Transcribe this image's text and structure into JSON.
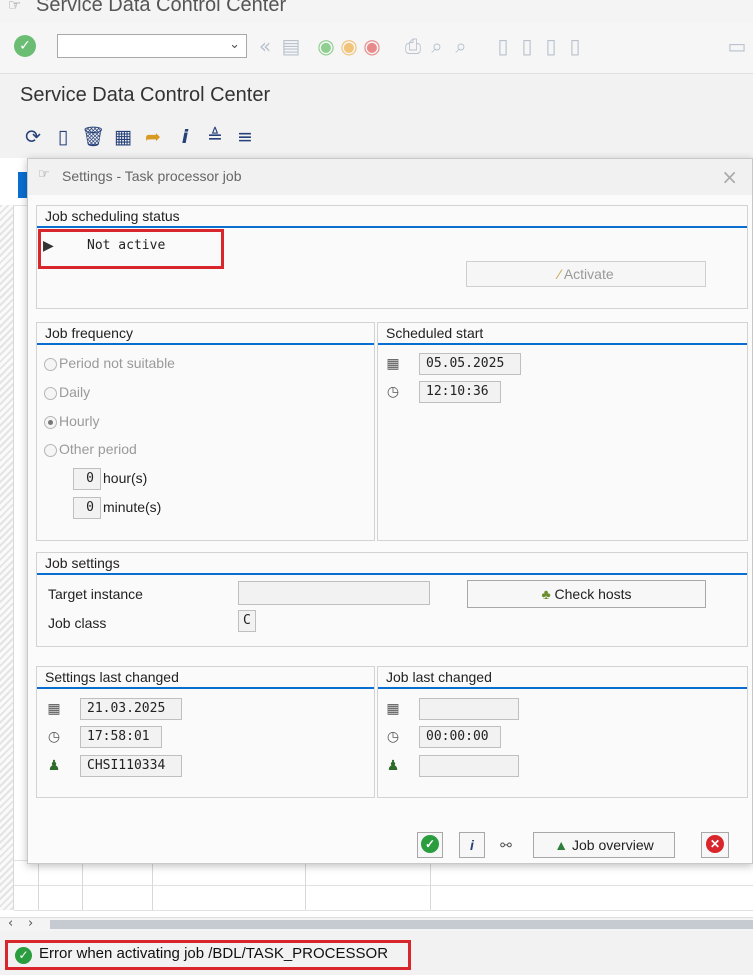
{
  "window": {
    "title": "Service Data Control Center"
  },
  "app": {
    "title": "Service Data Control Center"
  },
  "toolbar": {
    "command_field_value": ""
  },
  "dialog": {
    "title": "Settings - Task processor job",
    "status_group": {
      "heading": "Job scheduling status",
      "status": "Not active",
      "activate_label": "Activate"
    },
    "frequency": {
      "heading": "Job frequency",
      "options": [
        "Period not suitable",
        "Daily",
        "Hourly",
        "Other period"
      ],
      "selected": "Hourly",
      "hours_value": "0",
      "hours_label": "hour(s)",
      "minutes_value": "0",
      "minutes_label": "minute(s)"
    },
    "scheduled_start": {
      "heading": "Scheduled start",
      "date": "05.05.2025",
      "time": "12:10:36"
    },
    "job_settings": {
      "heading": "Job settings",
      "target_instance_label": "Target instance",
      "target_instance_value": "",
      "job_class_label": "Job class",
      "job_class_value": "C",
      "check_hosts_label": "Check hosts"
    },
    "settings_last_changed": {
      "heading": "Settings last changed",
      "date": "21.03.2025",
      "time": "17:58:01",
      "user": "CHSI110334"
    },
    "job_last_changed": {
      "heading": "Job last changed",
      "date": "",
      "time": "00:00:00",
      "user": ""
    },
    "footer": {
      "job_overview_label": "Job overview"
    }
  },
  "status_bar": {
    "message": "Error when activating job /BDL/TASK_PROCESSOR",
    "type": "success"
  },
  "colors": {
    "accent": "#0a6ed1",
    "highlight": "#d9262d",
    "ok": "#2a9d3f",
    "cancel": "#d9262d"
  }
}
